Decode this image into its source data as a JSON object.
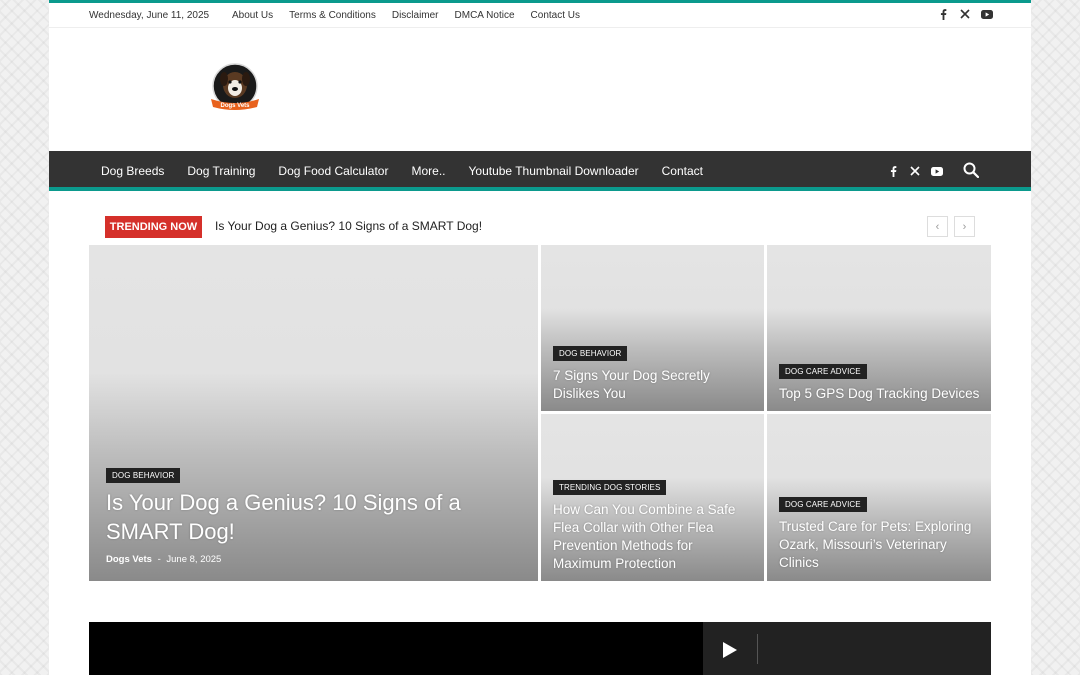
{
  "topbar": {
    "date": "Wednesday, June 11, 2025",
    "links": [
      "About Us",
      "Terms & Conditions",
      "Disclaimer",
      "DMCA Notice",
      "Contact Us"
    ],
    "social_icons": [
      "facebook-icon",
      "x-icon",
      "youtube-icon"
    ]
  },
  "logo": {
    "text": "Dogs Vets"
  },
  "nav": {
    "items": [
      "Dog Breeds",
      "Dog Training",
      "Dog Food Calculator",
      "More..",
      "Youtube Thumbnail Downloader",
      "Contact"
    ],
    "social_icons": [
      "facebook-icon",
      "x-icon",
      "youtube-icon"
    ],
    "search_icon": "search-icon"
  },
  "trending": {
    "label": "TRENDING NOW",
    "title": "Is Your Dog a Genius? 10 Signs of a SMART Dog!",
    "prev": "‹",
    "next": "›"
  },
  "featured": {
    "main": {
      "category": "DOG BEHAVIOR",
      "title": "Is Your Dog a Genius? 10 Signs of a SMART Dog!",
      "author": "Dogs Vets",
      "separator": "-",
      "date": "June 8, 2025"
    },
    "tiles": [
      {
        "category": "DOG BEHAVIOR",
        "title": "7 Signs Your Dog Secretly Dislikes You"
      },
      {
        "category": "DOG CARE ADVICE",
        "title": "Top 5 GPS Dog Tracking Devices"
      },
      {
        "category": "TRENDING DOG STORIES",
        "title": "How Can You Combine a Safe Flea Collar with Other Flea Prevention Methods for Maximum Protection"
      },
      {
        "category": "DOG CARE ADVICE",
        "title": "Trusted Care for Pets: Exploring Ozark, Missouri’s Veterinary Clinics"
      }
    ]
  },
  "colors": {
    "accent": "#0b9a8d",
    "nav_bg": "#333333",
    "trending_red": "#d5302a"
  }
}
